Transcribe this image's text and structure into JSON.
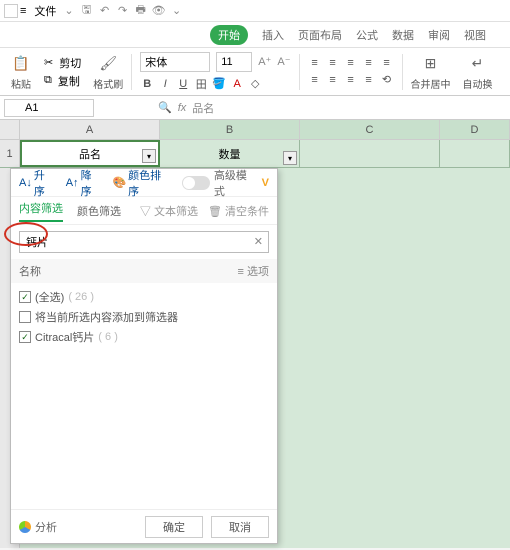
{
  "menubar": {
    "file": "文件"
  },
  "tabs": [
    "开始",
    "插入",
    "页面布局",
    "公式",
    "数据",
    "审阅",
    "视图"
  ],
  "ribbon": {
    "paste": "粘贴",
    "cut": "剪切",
    "copy": "复制",
    "format_paint": "格式刷",
    "font": "宋体",
    "size": "11",
    "merge": "合并居中",
    "wrap": "自动换"
  },
  "namebox": {
    "cell": "A1",
    "fx": "fx",
    "value": "品名"
  },
  "cols": [
    "A",
    "B",
    "C",
    "D"
  ],
  "row1": {
    "num": "1",
    "a": "品名",
    "b": "数量"
  },
  "panel": {
    "sort": {
      "asc": "升序",
      "desc": "降序",
      "color": "颜色排序",
      "adv": "高级模式"
    },
    "tabs": {
      "content": "内容筛选",
      "color": "颜色筛选",
      "text": "文本筛选",
      "clear": "清空条件"
    },
    "search": {
      "value": "钙片"
    },
    "hdr": {
      "name": "名称",
      "options": "选项"
    },
    "items": [
      {
        "checked": true,
        "label": "(全选)",
        "count": "( 26 )"
      },
      {
        "checked": false,
        "label": "将当前所选内容添加到筛选器",
        "count": ""
      },
      {
        "checked": true,
        "label": "Citracal钙片",
        "count": "( 6 )"
      }
    ],
    "foot": {
      "analysis": "分析",
      "ok": "确定",
      "cancel": "取消"
    }
  }
}
